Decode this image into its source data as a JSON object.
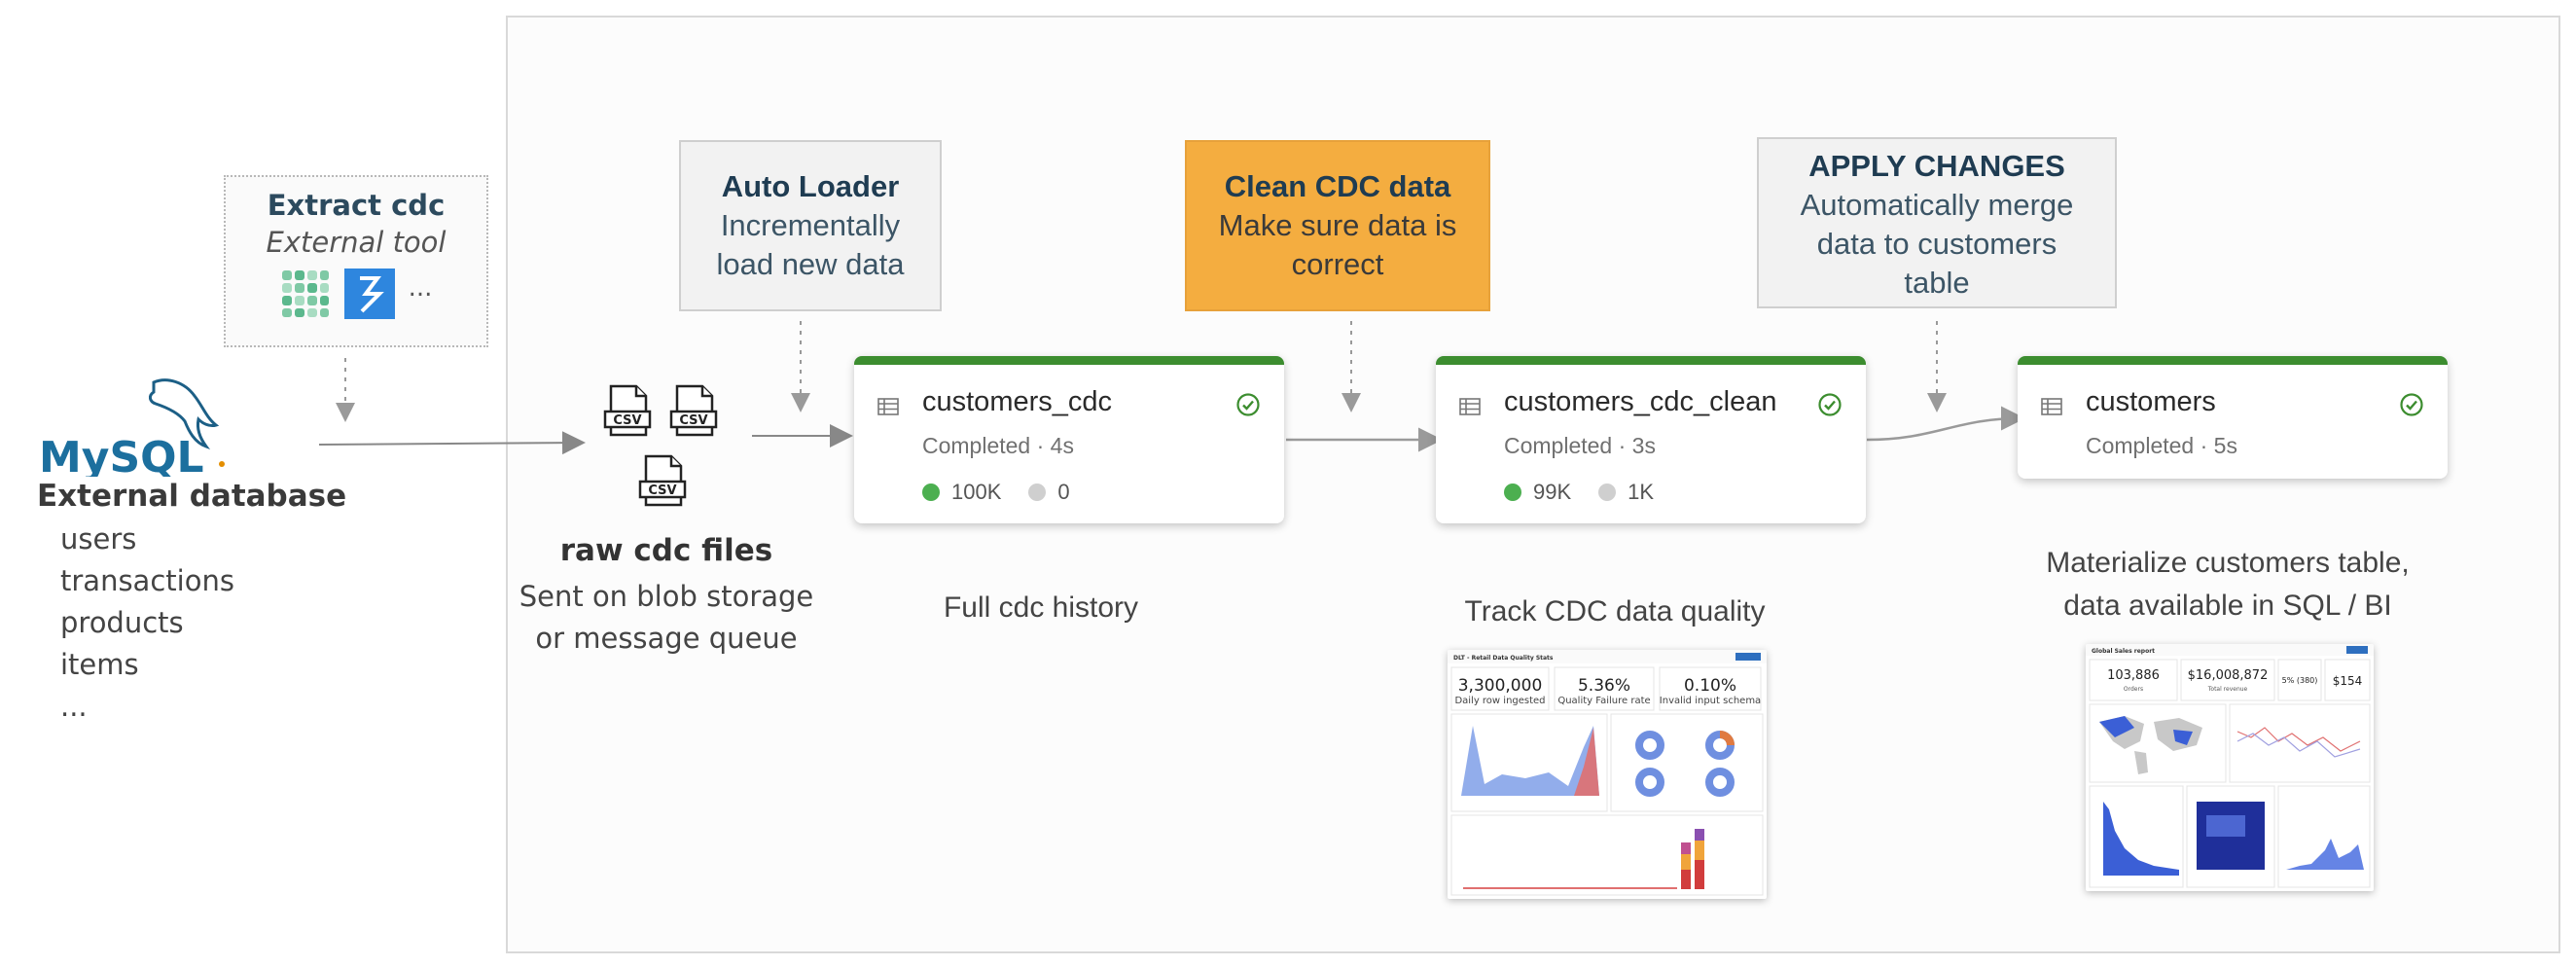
{
  "source": {
    "logo_text": "MySQL",
    "title": "External database",
    "tables": [
      "users",
      "transactions",
      "products",
      "items",
      "..."
    ]
  },
  "extract": {
    "title": "Extract cdc",
    "subtitle": "External tool",
    "ellipsis": "..."
  },
  "raw_files": {
    "file_label": "CSV",
    "title": "raw cdc files",
    "desc_line1": "Sent on blob storage",
    "desc_line2": "or message queue"
  },
  "stages": [
    {
      "title": "Auto Loader",
      "lines": [
        "Incrementally",
        "load new data"
      ],
      "highlight": false
    },
    {
      "title": "Clean CDC data",
      "lines": [
        "Make sure data is",
        "correct"
      ],
      "highlight": true
    },
    {
      "title": "APPLY CHANGES",
      "lines": [
        "Automatically merge",
        "data to customers",
        "table"
      ],
      "highlight": false
    }
  ],
  "nodes": [
    {
      "name": "customers_cdc",
      "status": "Completed · 4s",
      "written": "100K",
      "dropped": "0"
    },
    {
      "name": "customers_cdc_clean",
      "status": "Completed · 3s",
      "written": "99K",
      "dropped": "1K"
    },
    {
      "name": "customers",
      "status": "Completed · 5s"
    }
  ],
  "captions": {
    "cdc_history": "Full cdc history",
    "quality": "Track CDC data quality",
    "materialize_line1": "Materialize customers table,",
    "materialize_line2": "data available in SQL / BI"
  },
  "dq_dashboard": {
    "title": "DLT - Retail Data Quality Stats",
    "kpis": [
      {
        "value": "3,300,000",
        "label": "Daily row ingested"
      },
      {
        "value": "5.36%",
        "label": "Quality Failure rate"
      },
      {
        "value": "0.10%",
        "label": "Invalid input schema"
      }
    ]
  },
  "sales_dashboard": {
    "title": "Global Sales report",
    "kpis": [
      {
        "value": "103,886",
        "label": "Orders"
      },
      {
        "value": "$16,008,872",
        "label": "Total revenue"
      },
      {
        "value": "5% (380)",
        "label": ""
      },
      {
        "value": "$154",
        "label": ""
      }
    ]
  },
  "colors": {
    "node_ok": "#3c8d2f",
    "stage_highlight": "#f4ad40",
    "stage_default": "#f2f2f2",
    "title_text": "#1f3c52"
  }
}
